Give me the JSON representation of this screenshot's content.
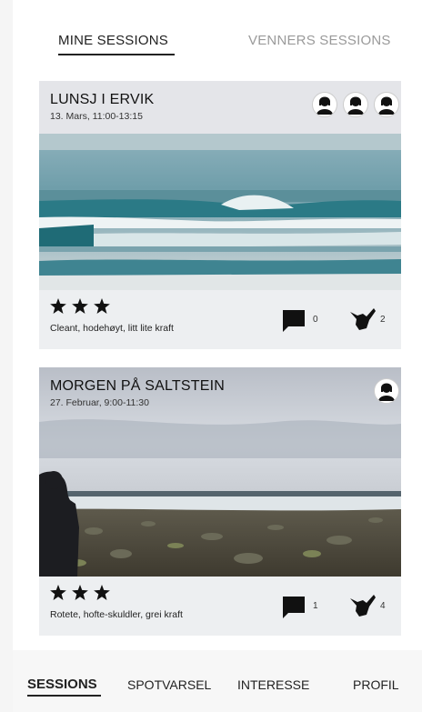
{
  "tabs": {
    "mine": "MINE SESSIONS",
    "friends": "VENNERS SESSIONS"
  },
  "sessions": [
    {
      "title": "LUNSJ I ERVIK",
      "date": "13. Mars, 11:00-13:15",
      "rating": 3,
      "description": "Cleant, hodehøyt, litt lite kraft",
      "comments": "0",
      "shakas": "2",
      "participants": 3,
      "photo": "ocean-waves"
    },
    {
      "title": "MORGEN PÅ SALTSTEIN",
      "date": "27. Februar, 9:00-11:30",
      "rating": 3,
      "description": "Rotete, hofte-skuldler, grei kraft",
      "comments": "1",
      "shakas": "4",
      "participants": 1,
      "photo": "rocky-beach-with-surfer"
    }
  ],
  "bottom_nav": {
    "sessions": "SESSIONS",
    "spotvarsel": "SPOTVARSEL",
    "interesse": "INTERESSE",
    "profil": "PROFIL"
  },
  "icons": {
    "avatar": "user-avatar-icon",
    "star": "star-icon",
    "comment": "comment-icon",
    "shaka": "shaka-hand-icon"
  }
}
